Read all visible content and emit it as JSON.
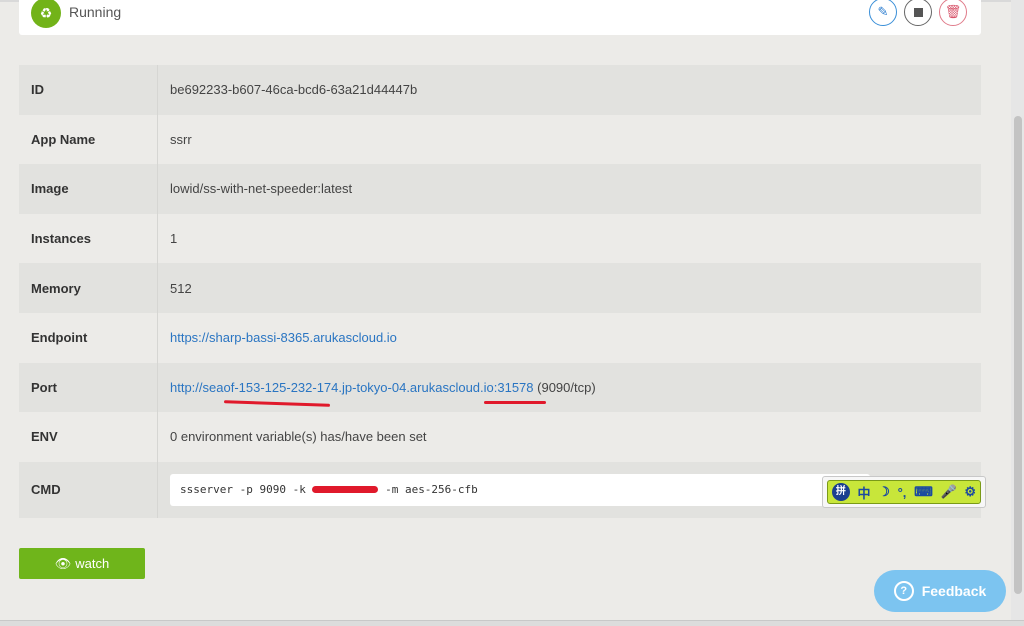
{
  "status": {
    "label": "Running",
    "icon": "recycle-icon"
  },
  "actions": {
    "edit": "✎",
    "delete": "🗑"
  },
  "details": {
    "id": {
      "key": "ID",
      "value": "be692233-b607-46ca-bcd6-63a21d44447b"
    },
    "app_name": {
      "key": "App Name",
      "value": "ssrr"
    },
    "image": {
      "key": "Image",
      "value": "lowid/ss-with-net-speeder:latest"
    },
    "instances": {
      "key": "Instances",
      "value": "1"
    },
    "memory": {
      "key": "Memory",
      "value": "512"
    },
    "endpoint": {
      "key": "Endpoint",
      "value": "https://sharp-bassi-8365.arukascloud.io"
    },
    "port": {
      "key": "Port",
      "value": "http://seaof-153-125-232-174.jp-tokyo-04.arukascloud.io:31578",
      "suffix": " (9090/tcp)"
    },
    "env": {
      "key": "ENV",
      "value": "0 environment variable(s) has/have been set"
    },
    "cmd": {
      "key": "CMD",
      "prefix": "ssserver -p 9090 -k ",
      "suffix": " -m aes-256-cfb"
    }
  },
  "ime": {
    "badge": "拼",
    "mode": "中",
    "icons": [
      "☽",
      "°,",
      "⌨",
      "🎤",
      "⚙"
    ]
  },
  "watch": {
    "label": "watch"
  },
  "feedback": {
    "label": "Feedback"
  },
  "colors": {
    "accent_green": "#6fb51b",
    "link_blue": "#2a75c2",
    "feedback_blue": "#7cc4f0",
    "markup_red": "#e0192b"
  }
}
